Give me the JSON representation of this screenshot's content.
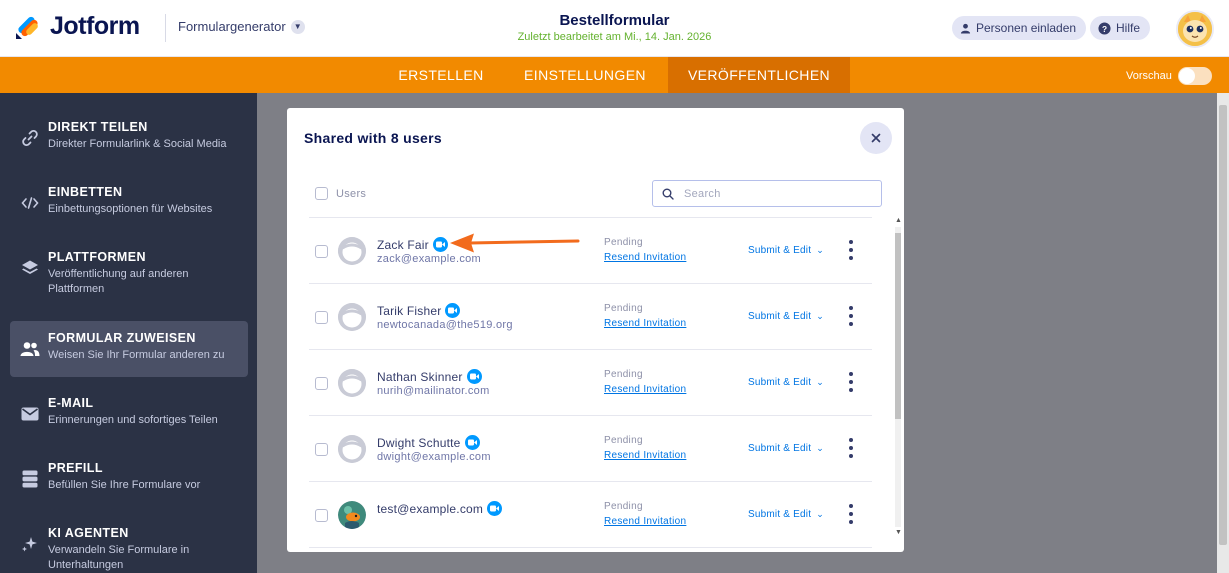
{
  "header": {
    "logo_text": "Jotform",
    "builder_label": "Formulargenerator",
    "form_title": "Bestellformular",
    "last_edited": "Zuletzt bearbeitet am Mi., 14. Jan. 2026",
    "invite_label": "Personen einladen",
    "help_label": "Hilfe"
  },
  "nav": {
    "tabs": [
      {
        "label": "ERSTELLEN"
      },
      {
        "label": "EINSTELLUNGEN"
      },
      {
        "label": "VERÖFFENTLICHEN"
      }
    ],
    "active_tab": "VERÖFFENTLICHEN",
    "preview_label": "Vorschau",
    "preview_on": false
  },
  "sidebar": {
    "items": [
      {
        "title": "DIREKT TEILEN",
        "desc": "Direkter Formularlink & Social Media",
        "icon": "link-icon"
      },
      {
        "title": "EINBETTEN",
        "desc": "Einbettungsoptionen für Websites",
        "icon": "code-icon"
      },
      {
        "title": "PLATTFORMEN",
        "desc": "Veröffentlichung auf anderen Plattformen",
        "icon": "layers-icon"
      },
      {
        "title": "FORMULAR ZUWEISEN",
        "desc": "Weisen Sie Ihr Formular anderen zu",
        "icon": "users-icon"
      },
      {
        "title": "E-MAIL",
        "desc": "Erinnerungen und sofortiges Teilen",
        "icon": "mail-icon"
      },
      {
        "title": "PREFILL",
        "desc": "Befüllen Sie Ihre Formulare vor",
        "icon": "database-icon"
      },
      {
        "title": "KI AGENTEN",
        "desc": "Verwandeln Sie Formulare in Unterhaltungen",
        "icon": "sparkle-icon"
      }
    ],
    "active_index": 3
  },
  "modal": {
    "title": "Shared with 8 users",
    "select_all_label": "Users",
    "search_placeholder": "Search",
    "search_value": "",
    "users": [
      {
        "name": "Zack Fair",
        "email": "zack@example.com",
        "status": "Pending",
        "resend": "Resend Invitation",
        "permission": "Submit & Edit",
        "avatar": "default"
      },
      {
        "name": "Tarik Fisher",
        "email": "newtocanada@the519.org",
        "status": "Pending",
        "resend": "Resend Invitation",
        "permission": "Submit & Edit",
        "avatar": "default"
      },
      {
        "name": "Nathan Skinner",
        "email": "nurih@mailinator.com",
        "status": "Pending",
        "resend": "Resend Invitation",
        "permission": "Submit & Edit",
        "avatar": "default"
      },
      {
        "name": "Dwight Schutte",
        "email": "dwight@example.com",
        "status": "Pending",
        "resend": "Resend Invitation",
        "permission": "Submit & Edit",
        "avatar": "default"
      },
      {
        "name": "",
        "email": "test@example.com",
        "status": "Pending",
        "resend": "Resend Invitation",
        "permission": "Submit & Edit",
        "avatar": "photo"
      }
    ]
  },
  "colors": {
    "brand_navy": "#0a1551",
    "nav_orange": "#f28a00",
    "nav_active": "#d86f00",
    "sidebar_bg": "#2b3245",
    "link_blue": "#0075e3",
    "badge_blue": "#0099ff",
    "annotation_arrow": "#f26b1d",
    "edited_green": "#64b22f"
  }
}
